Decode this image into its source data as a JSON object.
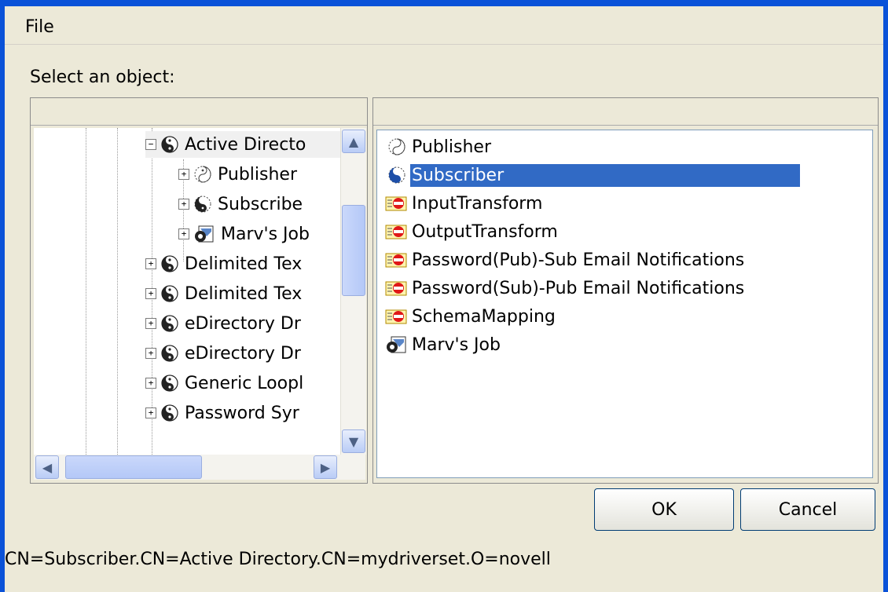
{
  "menu": {
    "file": "File"
  },
  "prompt": "Select an object:",
  "tree": {
    "items": [
      {
        "label": "Active Directo",
        "expander": "−",
        "icon": "yin-yang-icon",
        "selected": true
      },
      {
        "label": "Publisher",
        "expander": "+",
        "icon": "publisher-channel-icon"
      },
      {
        "label": "Subscribe",
        "expander": "+",
        "icon": "subscriber-channel-icon"
      },
      {
        "label": "Marv's Job",
        "expander": "+",
        "icon": "job-icon"
      },
      {
        "label": "Delimited Tex",
        "expander": "+",
        "icon": "yin-yang-icon"
      },
      {
        "label": "Delimited Tex",
        "expander": "+",
        "icon": "yin-yang-icon"
      },
      {
        "label": "eDirectory Dr",
        "expander": "+",
        "icon": "yin-yang-icon"
      },
      {
        "label": "eDirectory Dr",
        "expander": "+",
        "icon": "yin-yang-icon"
      },
      {
        "label": "Generic Loopl",
        "expander": "+",
        "icon": "yin-yang-icon"
      },
      {
        "label": "Password Syr",
        "expander": "+",
        "icon": "yin-yang-icon"
      }
    ]
  },
  "list": {
    "items": [
      {
        "label": "Publisher",
        "icon": "publisher-channel-icon"
      },
      {
        "label": "Subscriber",
        "icon": "subscriber-channel-icon",
        "selected": true
      },
      {
        "label": "InputTransform",
        "icon": "rule-icon"
      },
      {
        "label": "OutputTransform",
        "icon": "rule-icon"
      },
      {
        "label": "Password(Pub)-Sub Email Notifications",
        "icon": "rule-icon"
      },
      {
        "label": "Password(Sub)-Pub Email Notifications",
        "icon": "rule-icon"
      },
      {
        "label": "SchemaMapping",
        "icon": "rule-icon"
      },
      {
        "label": "Marv's Job",
        "icon": "job-icon"
      }
    ]
  },
  "buttons": {
    "ok": "OK",
    "cancel": "Cancel"
  },
  "status": "CN=Subscriber.CN=Active Directory.CN=mydriverset.O=novell",
  "colors": {
    "selection": "#316ac5",
    "window_frame": "#0a52d8",
    "dialog_bg": "#ece9d8"
  }
}
